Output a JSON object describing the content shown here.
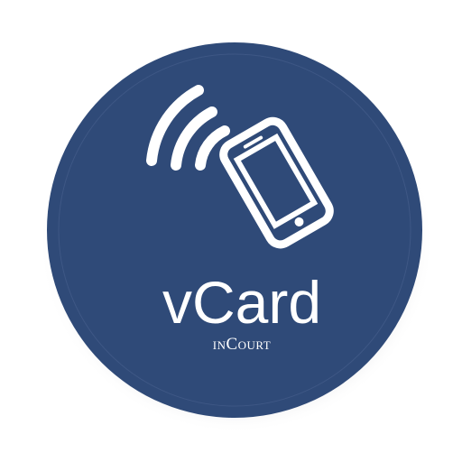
{
  "badge": {
    "title": "vCard",
    "subtitle": "inCourt",
    "icon": "nfc-phone-icon",
    "colors": {
      "background": "#2f4a78",
      "foreground": "#ffffff",
      "shadow": "#b9b9bd"
    }
  }
}
